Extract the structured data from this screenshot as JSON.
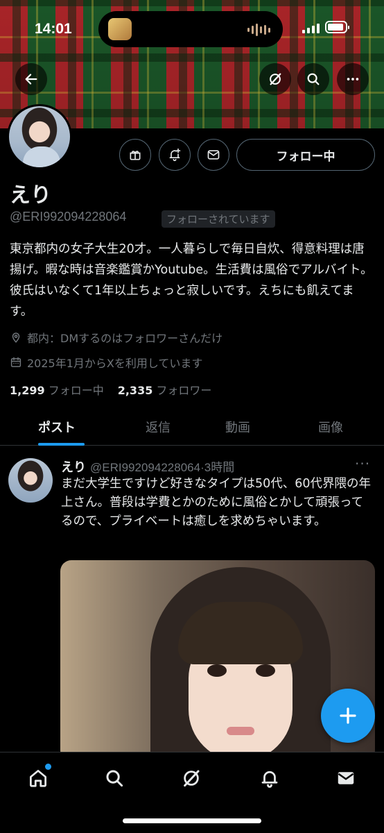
{
  "status_bar": {
    "time": "14:01"
  },
  "header": {
    "back_icon": "arrow-left-icon",
    "grok_icon": "grok-icon",
    "search_icon": "search-icon",
    "more_icon": "more-icon"
  },
  "profile": {
    "name": "えり",
    "handle": "@ERI992094228064",
    "follows_you": "フォローされています",
    "follow_button": "フォロー中",
    "bio": "東京都内の女子大生20才。一人暮らしで毎日自炊、得意料理は唐揚げ。暇な時は音楽鑑賞かYoutube。生活費は風俗でアルバイト。彼氏はいなくて1年以上ちょっと寂しいです。えちにも飢えてます。",
    "location": "都内：DMするのはフォロワーさんだけ",
    "joined": "2025年1月からXを利用しています",
    "following_count": "1,299",
    "following_label": "フォロー中",
    "followers_count": "2,335",
    "followers_label": "フォロワー"
  },
  "tabs": [
    {
      "label": "ポスト"
    },
    {
      "label": "返信"
    },
    {
      "label": "動画"
    },
    {
      "label": "画像"
    }
  ],
  "post": {
    "name": "えり",
    "handle": "@ERI992094228064",
    "separator": "·",
    "time": "3時間",
    "more": "···",
    "text": "まだ大学生ですけど好きなタイプは50代、60代界隈の年上さん。普段は学費とかのために風俗とかして頑張ってるので、プライベートは癒しを求めちゃいます。"
  },
  "bottom_nav": [
    {
      "icon": "home-icon"
    },
    {
      "icon": "search-icon"
    },
    {
      "icon": "grok-icon"
    },
    {
      "icon": "bell-icon"
    },
    {
      "icon": "mail-icon"
    }
  ],
  "colors": {
    "accent": "#1d9bf0",
    "background": "#000000",
    "text_primary": "#e7e9ea",
    "text_secondary": "#71767b",
    "border": "#2f3336"
  }
}
